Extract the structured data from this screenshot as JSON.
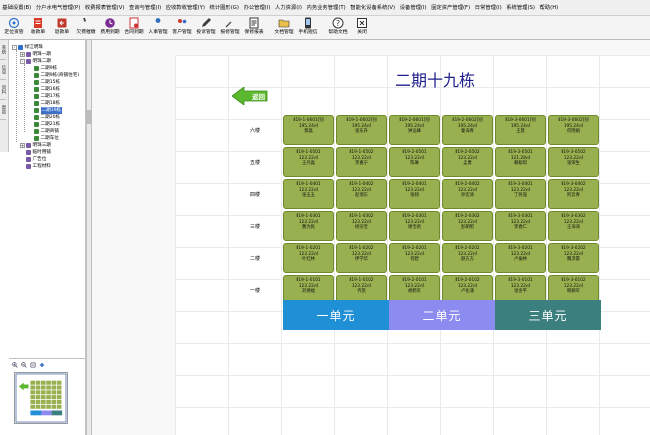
{
  "menu": [
    "基础设置(B)",
    "分户水电气管理(P)",
    "收费报表管理(V)",
    "查询与管理(I)",
    "应收款收管理(Y)",
    "统计图形(G)",
    "办公管理(I)",
    "人力资源(I)",
    "内务业务管理(T)",
    "智能化设备系统(V)",
    "设备管理(I)",
    "固定资产管理(F)",
    "日常管理(I)",
    "系统管理(S)",
    "帮助(H)"
  ],
  "toolbar": {
    "buttons": [
      {
        "label": "定位资管",
        "icon": "locate-icon",
        "color": "#2a6fd1"
      },
      {
        "label": "收款单",
        "icon": "receipt-icon",
        "color": "#d83a2a"
      },
      {
        "label": "退款单",
        "icon": "refund-icon",
        "color": "#c0392b"
      },
      {
        "label": "欠费催缴",
        "icon": "phone-icon",
        "color": "#444444"
      },
      {
        "label": "费用到期",
        "icon": "clock-icon",
        "color": "#7a2a92"
      },
      {
        "label": "合同到期",
        "icon": "contract-icon",
        "color": "#cc3333"
      },
      {
        "label": "人事管理",
        "icon": "person-icon",
        "color": "#2f6ebd"
      },
      {
        "label": "客户管理",
        "icon": "users-icon",
        "color": "#c73a2c"
      },
      {
        "label": "投诉管理",
        "icon": "pen-icon",
        "color": "#3c3c3c"
      },
      {
        "label": "报修管理",
        "icon": "wrench-icon",
        "color": "#555555"
      },
      {
        "label": "保修报表",
        "icon": "document-icon",
        "color": "#333333"
      },
      {
        "label": "文档管理",
        "icon": "folder-icon",
        "color": "#333333"
      },
      {
        "label": "手机短信",
        "icon": "phone-message-icon",
        "color": "#333333"
      },
      {
        "label": "帮助文档",
        "icon": "help-icon",
        "color": "#333333"
      },
      {
        "label": "关闭",
        "icon": "close-icon",
        "color": "#333333"
      }
    ]
  },
  "side_tabs": [
    "系统",
    "信息",
    "资料",
    "帮助"
  ],
  "tree": [
    {
      "label": "绿江明珠",
      "level": 0,
      "expander": "-"
    },
    {
      "label": "明珠一期",
      "level": 1,
      "expander": "+"
    },
    {
      "label": "明珠二期",
      "level": 1,
      "expander": "-"
    },
    {
      "label": "二期9栋",
      "level": 2
    },
    {
      "label": "二期9栋(商铺住宅)",
      "level": 2
    },
    {
      "label": "二期15栋",
      "level": 2
    },
    {
      "label": "二期16栋",
      "level": 2
    },
    {
      "label": "二期17栋",
      "level": 2
    },
    {
      "label": "二期18栋",
      "level": 2
    },
    {
      "label": "二期19栋",
      "level": 2,
      "selected": true
    },
    {
      "label": "二期20栋",
      "level": 2
    },
    {
      "label": "二期21栋",
      "level": 2
    },
    {
      "label": "二期商铺",
      "level": 2
    },
    {
      "label": "二期车位",
      "level": 2
    },
    {
      "label": "明珠三期",
      "level": 1,
      "expander": "+"
    },
    {
      "label": "临时用铺",
      "level": 1
    },
    {
      "label": "广告位",
      "level": 1
    },
    {
      "label": "工程材料",
      "level": 1
    }
  ],
  "building": {
    "title": "二期十九栋",
    "back_label": "返回"
  },
  "floors": [
    "六楼",
    "五楼",
    "四楼",
    "三楼",
    "二楼",
    "一楼"
  ],
  "units": [
    {
      "label": "一单元",
      "color": "#1f8fd6"
    },
    {
      "label": "二单元",
      "color": "#8c8cf0"
    },
    {
      "label": "三单元",
      "color": "#3c7f7f"
    }
  ],
  "rooms": [
    [
      {
        "code": "Ⅱ19-1-0601[别",
        "area": "195.24㎡",
        "name": "蔡磊"
      },
      {
        "code": "Ⅱ19-1-0602[别",
        "area": "195.24㎡",
        "name": "张东升"
      },
      {
        "code": "Ⅱ19-2-0601[别",
        "area": "195.24㎡",
        "name": "钟远峰"
      },
      {
        "code": "Ⅱ19-2-0602[别",
        "area": "195.24㎡",
        "name": "秦海青"
      },
      {
        "code": "Ⅱ19-3-0601[别",
        "area": "195.24㎡",
        "name": "王莫"
      },
      {
        "code": "Ⅱ19-3-0602[别",
        "area": "195.24㎡",
        "name": "何晓娟"
      }
    ],
    [
      {
        "code": "Ⅱ19-1-0501",
        "area": "123.22㎡",
        "name": "王丹磊"
      },
      {
        "code": "Ⅱ19-1-0502",
        "area": "123.22㎡",
        "name": "李嘉宁"
      },
      {
        "code": "Ⅱ19-2-0501",
        "area": "123.22㎡",
        "name": "陈琳"
      },
      {
        "code": "Ⅱ19-2-0502",
        "area": "123.22㎡",
        "name": "孟勇"
      },
      {
        "code": "Ⅱ19-3-0501",
        "area": "121.28㎡",
        "name": "赖聪琪"
      },
      {
        "code": "Ⅱ19-3-0502",
        "area": "123.22㎡",
        "name": "张荣生"
      }
    ],
    [
      {
        "code": "Ⅱ19-1-0401",
        "area": "123.22㎡",
        "name": "张玉玉"
      },
      {
        "code": "Ⅱ19-1-0402",
        "area": "123.22㎡",
        "name": "赵瑞东"
      },
      {
        "code": "Ⅱ19-2-0401",
        "area": "123.22㎡",
        "name": "张翔"
      },
      {
        "code": "Ⅱ19-2-0402",
        "area": "123.22㎡",
        "name": "孙宏涛"
      },
      {
        "code": "Ⅱ19-3-0401",
        "area": "123.22㎡",
        "name": "丁民强"
      },
      {
        "code": "Ⅱ19-3-0402",
        "area": "123.22㎡",
        "name": "阿云青"
      }
    ],
    [
      {
        "code": "Ⅱ19-1-0301",
        "area": "123.22㎡",
        "name": "曹为民"
      },
      {
        "code": "Ⅱ19-1-0302",
        "area": "123.22㎡",
        "name": "杨宗宝"
      },
      {
        "code": "Ⅱ19-2-0301",
        "area": "123.22㎡",
        "name": "谢宝君"
      },
      {
        "code": "Ⅱ19-2-0302",
        "area": "123.22㎡",
        "name": "彭朝昭"
      },
      {
        "code": "Ⅱ19-3-0301",
        "area": "123.22㎡",
        "name": "李春仁"
      },
      {
        "code": "Ⅱ19-3-0302",
        "area": "123.22㎡",
        "name": "王海涛"
      }
    ],
    [
      {
        "code": "Ⅱ19-1-0201",
        "area": "123.22㎡",
        "name": "叶红林"
      },
      {
        "code": "Ⅱ19-1-0202",
        "area": "123.22㎡",
        "name": "伊学华"
      },
      {
        "code": "Ⅱ19-2-0201",
        "area": "123.22㎡",
        "name": "何碧"
      },
      {
        "code": "Ⅱ19-2-0202",
        "area": "123.22㎡",
        "name": "颜方方"
      },
      {
        "code": "Ⅱ19-3-0201",
        "area": "123.22㎡",
        "name": "卢振林"
      },
      {
        "code": "Ⅱ19-3-0202",
        "area": "123.22㎡",
        "name": "魏凉雷"
      }
    ],
    [
      {
        "code": "Ⅱ19-1-0101",
        "area": "123.22㎡",
        "name": "刘德福"
      },
      {
        "code": "Ⅱ19-1-0102",
        "area": "123.22㎡",
        "name": "齐凯"
      },
      {
        "code": "Ⅱ19-2-0101",
        "area": "123.22㎡",
        "name": "胡鹤军"
      },
      {
        "code": "Ⅱ19-2-0102",
        "area": "123.22㎡",
        "name": "卢化涌"
      },
      {
        "code": "Ⅱ19-3-0101",
        "area": "123.22㎡",
        "name": "张金平"
      },
      {
        "code": "Ⅱ19-3-0102",
        "area": "123.22㎡",
        "name": "韩颖军"
      }
    ]
  ],
  "colors": {
    "room_fill": "#98b050",
    "title": "#1f1f8c",
    "back_arrow": "#5cb82e",
    "selection": "#3d6fc9"
  }
}
